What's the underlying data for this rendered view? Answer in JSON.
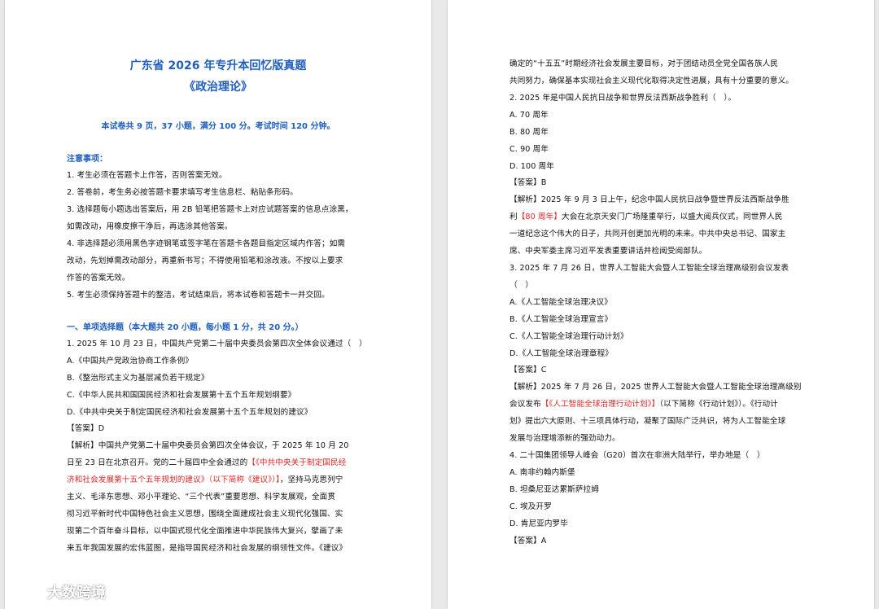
{
  "left": {
    "title1": "广东省 2026 年专升本回忆版真题",
    "title2": "《政治理论》",
    "meta": "本试卷共 9 页，37 小题，满分 100 分。考试时间 120 分钟。",
    "notice_head": "注意事项：",
    "notices": [
      "1. 考生必须在答题卡上作答，否则答案无效。",
      "2. 答卷前，考生务必按答题卡要求填写考生信息栏、粘贴条形码。",
      "3. 选择题每小题选出答案后，用 2B 铅笔把答题卡上对应试题答案的信息点涂黑，",
      "如需改动，用橡皮擦干净后，再选涂其他答案。",
      "4. 非选择题必须用黑色字迹钢笔或签字笔在答题卡各题目指定区域内作答；如需",
      "改动，先划掉需改动部分，再重新书写；不得使用铅笔和涂改液。不按以上要求",
      "作答的答案无效。",
      "5. 考生必须保持答题卡的整洁，考试结束后，将本试卷和答题卡一并交回。"
    ],
    "section_head": "一、单项选择题（本大题共 20 小题，每小题 1 分，共 20 分。）",
    "q1": "1. 2025 年 10 月 23 日，中国共产党第二十届中央委员会第四次全体会议通过（　）",
    "q1_options": [
      "A.《中国共产党政治协商工作条例》",
      "B.《整治形式主义为基层减负若干规定》",
      "C.《中华人民共和国国民经济和社会发展第十五个五年规划纲要》",
      "D.《中共中央关于制定国民经济和社会发展第十五个五年规划的建议》"
    ],
    "q1_answer": "【答案】D",
    "q1_exp": {
      "l1": "【解析】中国共产党第二十届中央委员会第四次全体会议，于 2025 年 10 月 20",
      "l2a": "日至 23 日在北京召开。党的二十届四中全会通过的",
      "l2b": "【《中共中央关于制定国民经",
      "l3a": "济和社会发展第十五个五年规划的建议》（以下简称《建议》）】",
      "l3b": "，坚持马克思列宁",
      "l4": "主义、毛泽东思想、邓小平理论、“三个代表”重要思想、科学发展观，全面贯",
      "l5": "彻习近平新时代中国特色社会主义思想，围绕全面建成社会主义现代化强国、实",
      "l6": "现第二个百年奋斗目标，以中国式现代化全面推进中华民族伟大复兴，擘画了未",
      "l7": "来五年我国发展的宏伟蓝图，是指导国民经济和社会发展的纲领性文件。《建议》"
    }
  },
  "right": {
    "cont1": "确定的“十五五”时期经济社会发展主要目标，对于团结动员全党全国各族人民",
    "cont2": "共同努力，确保基本实现社会主义现代化取得决定性进展，具有十分重要的意义。",
    "q2": "2. 2025 年是中国人民抗日战争和世界反法西斯战争胜利（　）。",
    "q2_options": [
      "A. 70 周年",
      "B. 80 周年",
      "C. 90 周年",
      "D. 100 周年"
    ],
    "q2_answer": "【答案】B",
    "q2_exp": {
      "l1": "【解析】2025 年 9 月 3 日上午，纪念中国人民抗日战争暨世界反法西斯战争胜",
      "l2a": "利",
      "l2b": "【80 周年】",
      "l2c": "大会在北京天安门广场隆重举行，以盛大阅兵仪式，同世界人民",
      "l3": "一道纪念这个伟大的日子，共同开创更加光明的未来。中共中央总书记、国家主",
      "l4": "席、中央军委主席习近平发表重要讲话并检阅受阅部队。"
    },
    "q3": "3. 2025 年 7 月 26 日，世界人工智能大会暨人工智能全球治理高级别会议发表",
    "q3_paren": "（　）",
    "q3_options": [
      "A.《人工智能全球治理决议》",
      "B.《人工智能全球治理宣言》",
      "C.《人工智能全球治理行动计划》",
      "D.《人工智能全球治理章程》"
    ],
    "q3_answer": "【答案】C",
    "q3_exp": {
      "l1": "【解析】2025 年 7 月 26 日，2025 世界人工智能大会暨人工智能全球治理高级别",
      "l2a": "会议发布",
      "l2b": "【《人工智能全球治理行动计划》】",
      "l2c": "（以下简称《行动计划》）。《行动计",
      "l3": "划》提出六大原则、十三项具体行动，凝聚了国际广泛共识，将为人工智能全球",
      "l4": "发展与治理增添新的强劲动力。"
    },
    "q4": "4. 二十国集团领导人峰会（G20）首次在非洲大陆举行，举办地是（　）",
    "q4_options": [
      "A. 南非约翰内斯堡",
      "B. 坦桑尼亚达累斯萨拉姆",
      "C. 埃及开罗",
      "D. 肯尼亚内罗毕"
    ],
    "q4_answer": "【答案】A"
  },
  "watermark": "大数跨境",
  "colors": {
    "heading_blue": "#1f5fbf",
    "highlight_red": "#e02525"
  }
}
